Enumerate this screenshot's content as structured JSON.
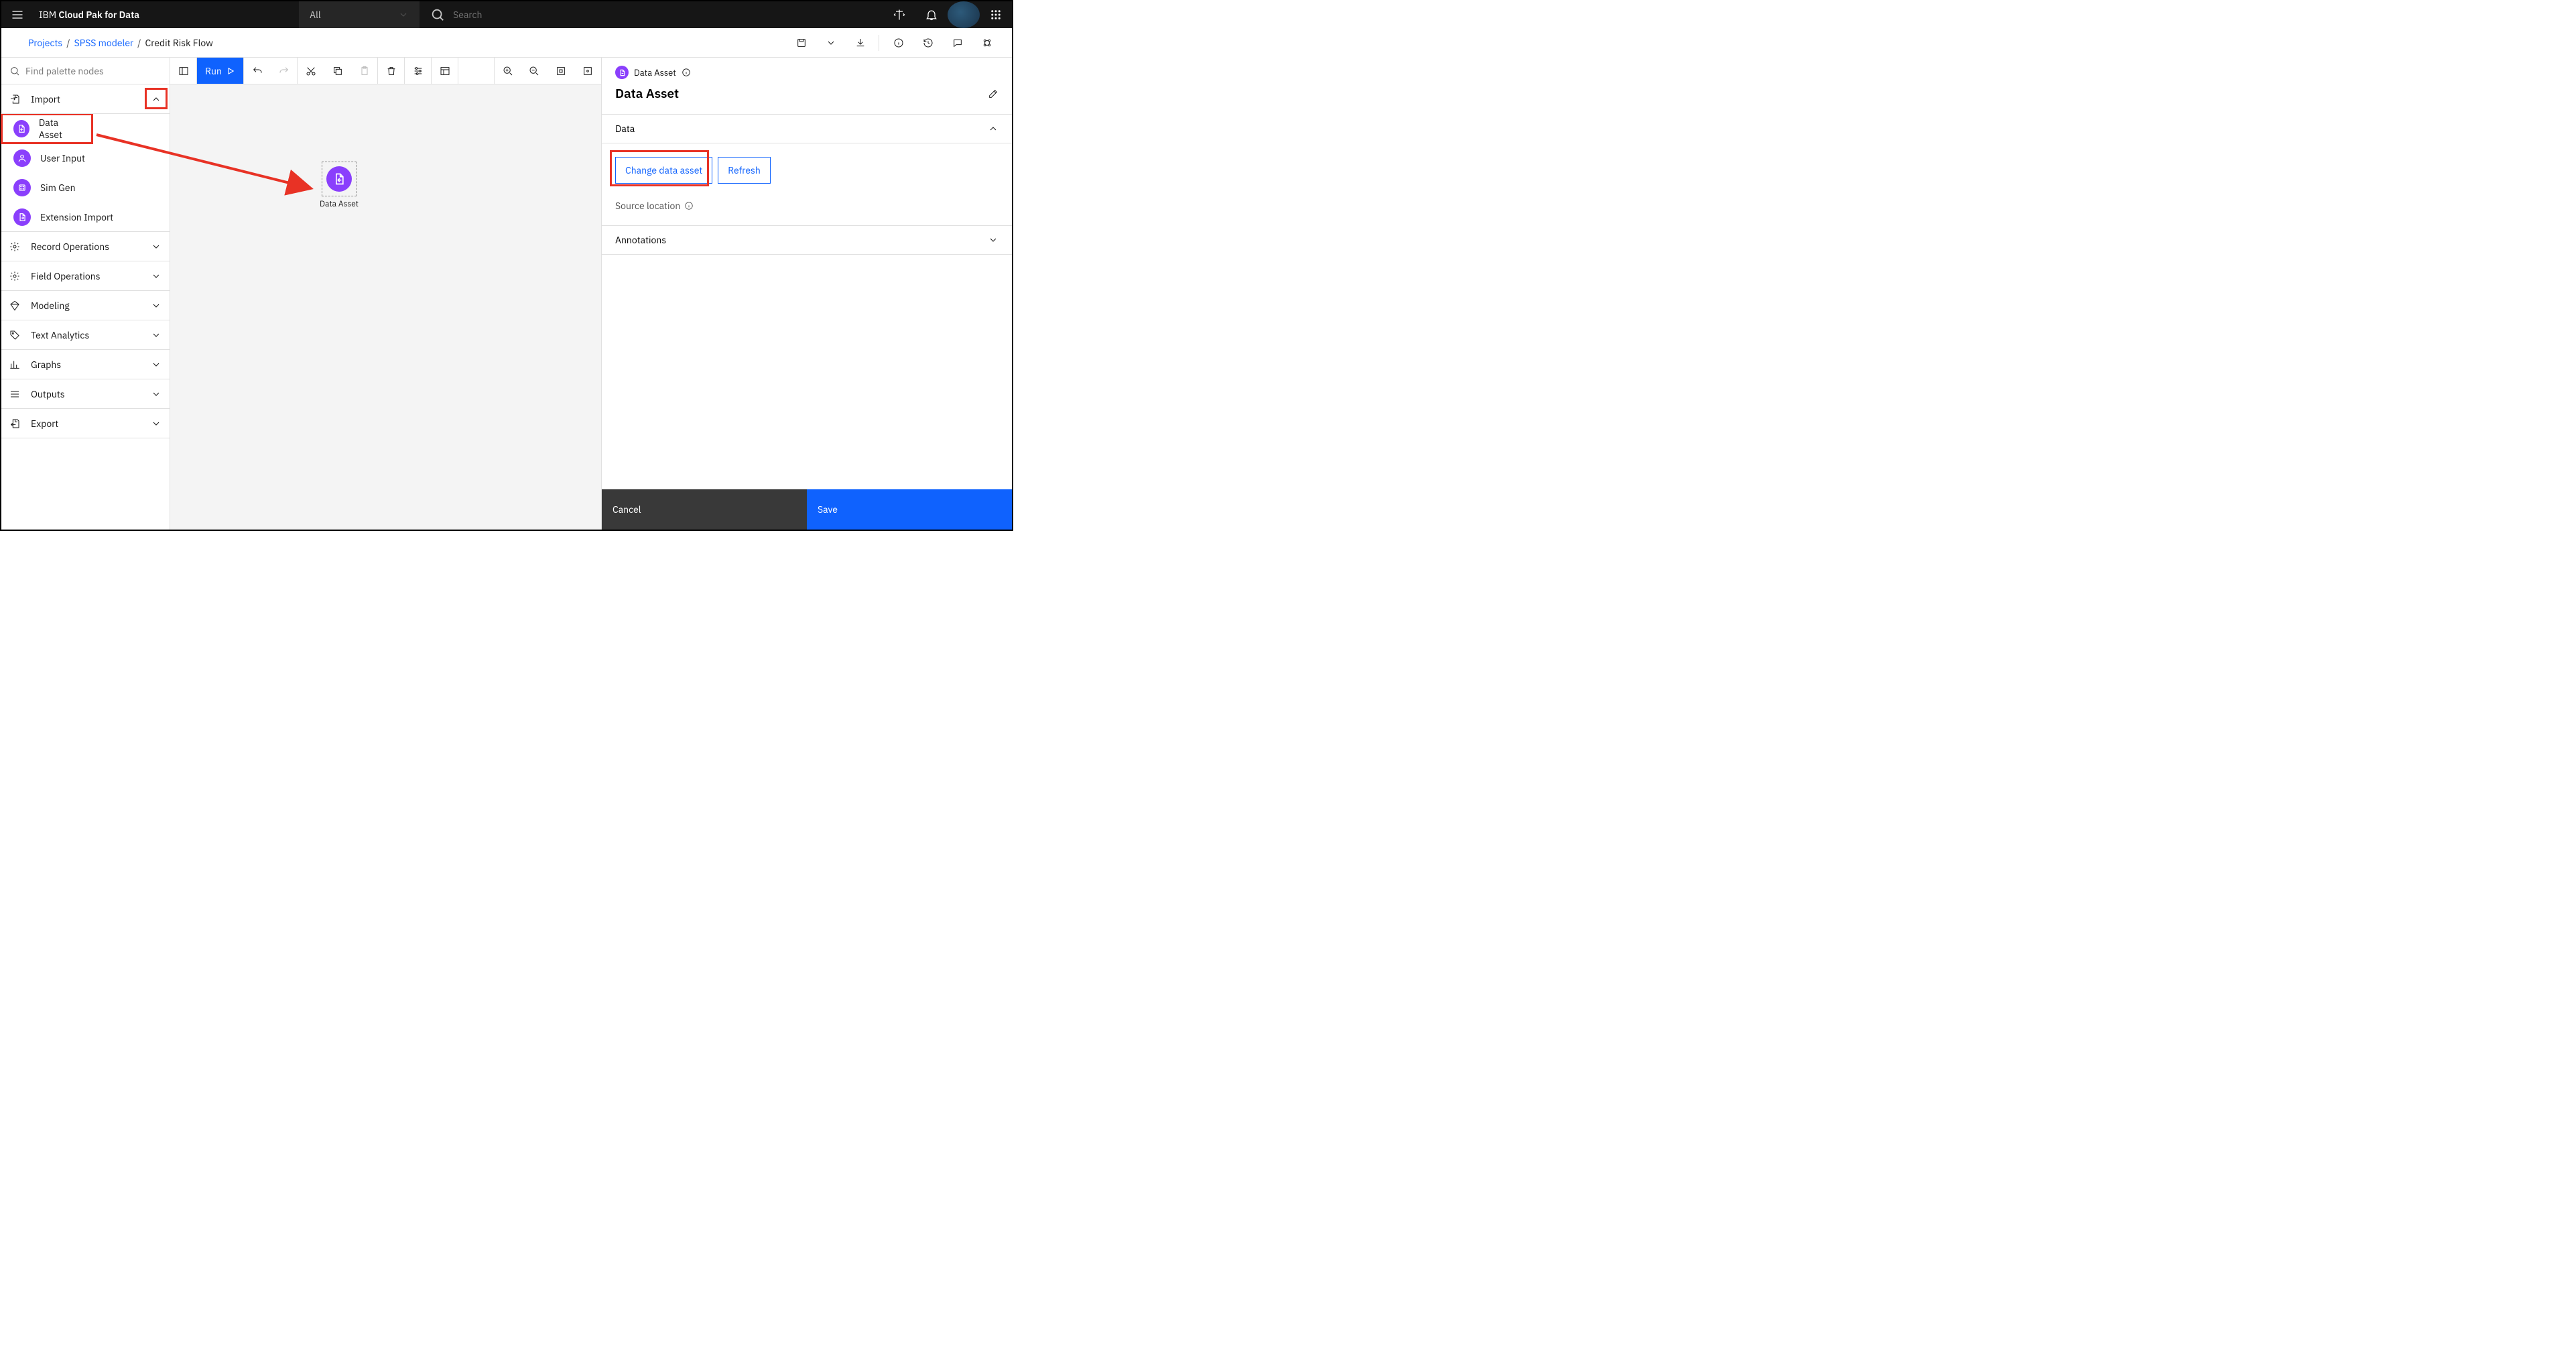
{
  "topbar": {
    "brand_prefix": "IBM ",
    "brand_bold": "Cloud Pak for Data",
    "scope_label": "All",
    "search_placeholder": "Search"
  },
  "breadcrumb": {
    "projects": "Projects",
    "spss": "SPSS modeler",
    "current": "Credit Risk Flow"
  },
  "palette": {
    "search_placeholder": "Find palette nodes",
    "categories": {
      "import": "Import",
      "record_ops": "Record Operations",
      "field_ops": "Field Operations",
      "modeling": "Modeling",
      "text_analytics": "Text Analytics",
      "graphs": "Graphs",
      "outputs": "Outputs",
      "export": "Export"
    },
    "import_nodes": {
      "data_asset": "Data Asset",
      "user_input": "User Input",
      "sim_gen": "Sim Gen",
      "ext_import": "Extension Import"
    }
  },
  "toolbar": {
    "run_label": "Run"
  },
  "canvas": {
    "node_label": "Data Asset"
  },
  "rpanel": {
    "bc_label": "Data Asset",
    "title": "Data Asset",
    "section_data": "Data",
    "change_btn": "Change data asset",
    "refresh_btn": "Refresh",
    "source_loc": "Source location",
    "section_annotations": "Annotations",
    "cancel": "Cancel",
    "save": "Save"
  }
}
